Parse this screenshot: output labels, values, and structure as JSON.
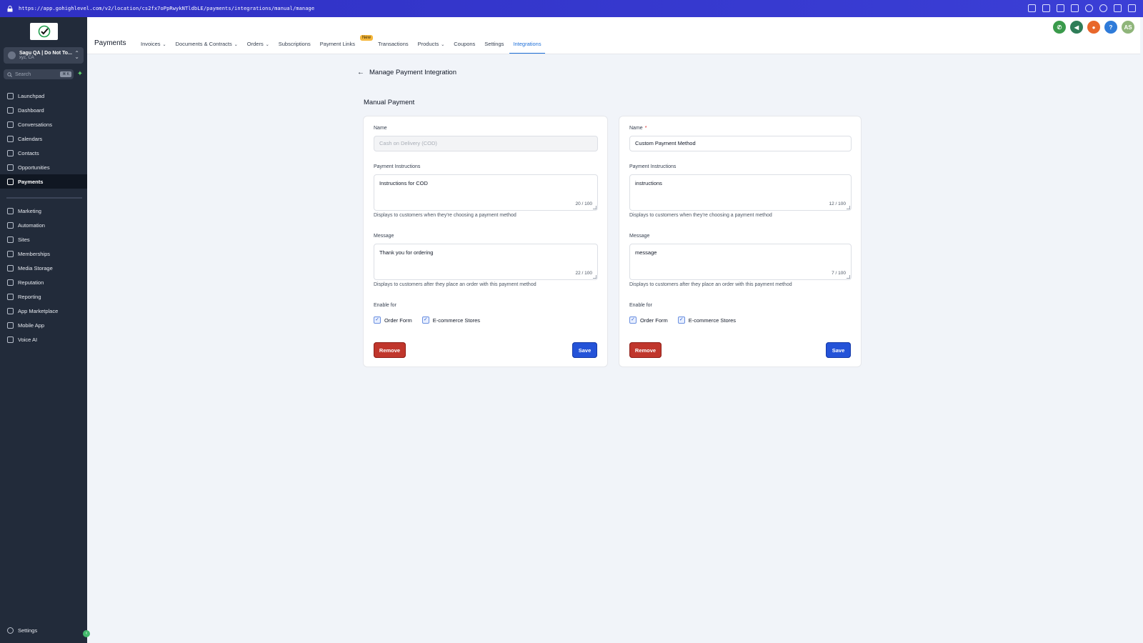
{
  "browser": {
    "url": "https://app.gohighlevel.com/v2/location/cs2fx7oPpRwykNTldbLE/payments/integrations/manual/manage"
  },
  "sidebar": {
    "account": {
      "name": "Sagu QA | Do Not To...",
      "location": "xyz, CA"
    },
    "search": {
      "placeholder": "Search",
      "shortcut": "⌘ K"
    },
    "items": [
      {
        "label": "Launchpad",
        "icon": "rocket-icon"
      },
      {
        "label": "Dashboard",
        "icon": "grid-icon"
      },
      {
        "label": "Conversations",
        "icon": "chat-icon"
      },
      {
        "label": "Calendars",
        "icon": "calendar-icon"
      },
      {
        "label": "Contacts",
        "icon": "contacts-icon"
      },
      {
        "label": "Opportunities",
        "icon": "opportunities-icon"
      },
      {
        "label": "Payments",
        "icon": "payments-icon",
        "active": true
      }
    ],
    "items2": [
      {
        "label": "Marketing",
        "icon": "send-icon"
      },
      {
        "label": "Automation",
        "icon": "automation-icon"
      },
      {
        "label": "Sites",
        "icon": "sites-icon"
      },
      {
        "label": "Memberships",
        "icon": "memberships-icon"
      },
      {
        "label": "Media Storage",
        "icon": "media-icon"
      },
      {
        "label": "Reputation",
        "icon": "star-icon"
      },
      {
        "label": "Reporting",
        "icon": "chart-icon"
      },
      {
        "label": "App Marketplace",
        "icon": "apps-icon"
      },
      {
        "label": "Mobile App",
        "icon": "mobile-icon"
      },
      {
        "label": "Voice AI",
        "icon": "phone-icon"
      }
    ],
    "settings_label": "Settings"
  },
  "header": {
    "title": "Payments",
    "tabs": [
      {
        "label": "Invoices",
        "dropdown": true
      },
      {
        "label": "Documents & Contracts",
        "dropdown": true
      },
      {
        "label": "Orders",
        "dropdown": true
      },
      {
        "label": "Subscriptions"
      },
      {
        "label": "Payment Links",
        "badge": "New"
      },
      {
        "label": "Transactions"
      },
      {
        "label": "Products",
        "dropdown": true
      },
      {
        "label": "Coupons"
      },
      {
        "label": "Settings"
      },
      {
        "label": "Integrations",
        "active": true
      }
    ],
    "avatar_initials": "AS",
    "colors": {
      "phone": "#3a9a4b",
      "megaphone": "#2f7d58",
      "bell": "#e8672b",
      "help": "#2f7bd9",
      "avatar": "#8fb57a"
    }
  },
  "page": {
    "back_title": "Manage Payment Integration",
    "section_title": "Manual Payment"
  },
  "cards": [
    {
      "name_label": "Name",
      "name_required": false,
      "name_value": "Cash on Delivery (COD)",
      "instructions_label": "Payment Instructions",
      "instructions_value": "Instructions for COD",
      "instructions_count": "20 / 100",
      "instructions_hint": "Displays to customers when they're choosing a payment method",
      "message_label": "Message",
      "message_value": "Thank you for ordering",
      "message_count": "22 / 100",
      "message_hint": "Displays to customers after they place an order with this payment method",
      "enable_label": "Enable for",
      "order_form_label": "Order Form",
      "ecommerce_label": "E-commerce Stores",
      "remove_label": "Remove",
      "save_label": "Save"
    },
    {
      "name_label": "Name",
      "name_required": true,
      "name_value": "Custom Payment Method",
      "instructions_label": "Payment Instructions",
      "instructions_value": "instructions",
      "instructions_count": "12 / 100",
      "instructions_hint": "Displays to customers when they're choosing a payment method",
      "message_label": "Message",
      "message_value": "message",
      "message_count": "7 / 100",
      "message_hint": "Displays to customers after they place an order with this payment method",
      "enable_label": "Enable for",
      "order_form_label": "Order Form",
      "ecommerce_label": "E-commerce Stores",
      "remove_label": "Remove",
      "save_label": "Save"
    }
  ]
}
